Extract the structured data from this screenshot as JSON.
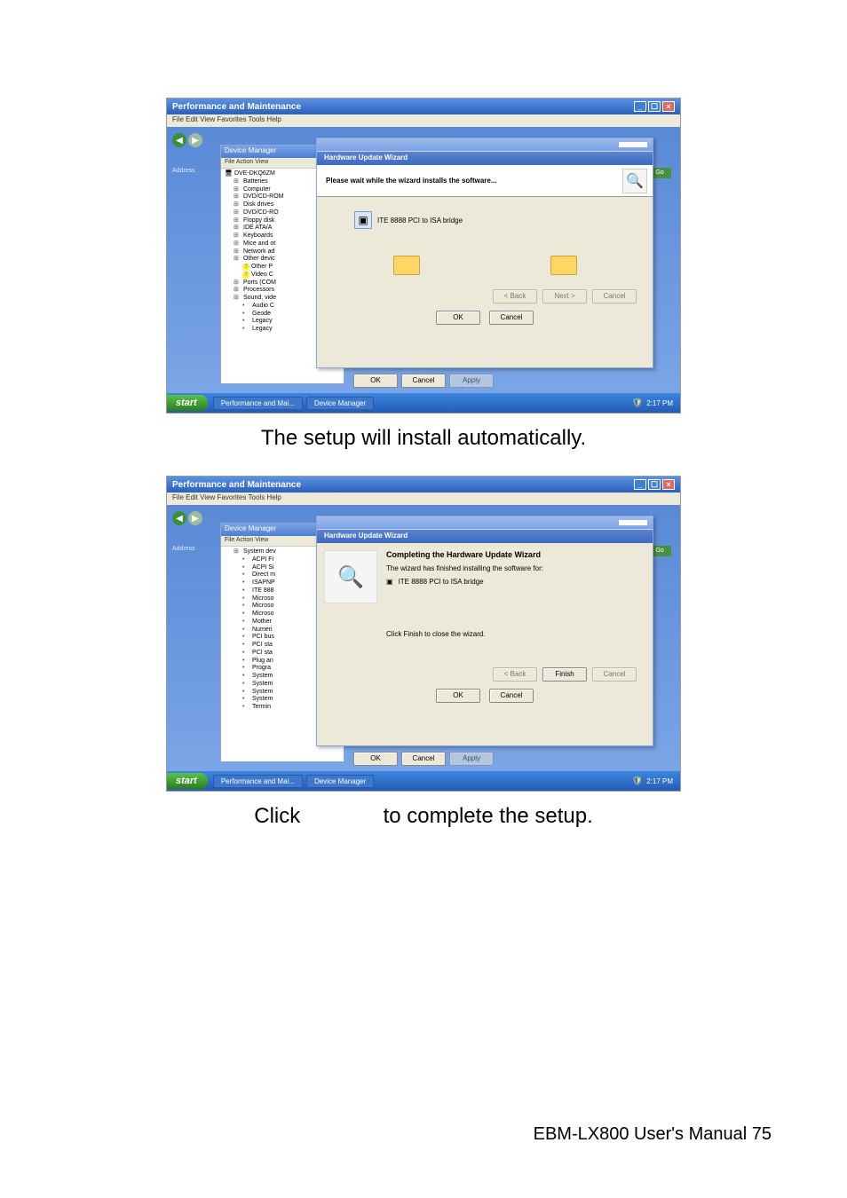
{
  "caption1": "The setup will install automatically.",
  "caption2": "Click              to complete the setup.",
  "footer": "EBM-LX800  User's  Manual 75",
  "strings": {
    "pm_title": "Performance and Maintenance",
    "pm_menu": "File   Edit   View   Favorites   Tools   Help",
    "go": "Go",
    "address": "Address",
    "dm_title": "Device Manager",
    "dm_menu": "File   Action   View",
    "prop_tag1": "?",
    "prop_tag2": "×",
    "wiz_title": "Hardware Update Wizard",
    "wiz_wait": "Please wait while the wizard installs the software...",
    "device": "ITE 8888 PCI to ISA bridge",
    "back": "< Back",
    "next": "Next >",
    "cancel": "Cancel",
    "ok": "OK",
    "apply": "Apply",
    "finish": "Finish",
    "complete_hdr": "Completing the Hardware Update Wizard",
    "complete_line": "The wizard has finished installing the software for:",
    "complete_finishmsg": "Click Finish to close the wizard.",
    "start": "start",
    "task1": "Performance and Mai...",
    "task2": "Device Manager",
    "time": "2:17 PM"
  },
  "tree1": [
    {
      "cls": "lvl0",
      "txt": "DVE-DKQ6ZM"
    },
    {
      "cls": "lvl1",
      "txt": "Batteries"
    },
    {
      "cls": "lvl1",
      "txt": "Computer"
    },
    {
      "cls": "lvl1",
      "txt": "DVD/CD-ROM"
    },
    {
      "cls": "lvl1",
      "txt": "Disk drives"
    },
    {
      "cls": "lvl1",
      "txt": "DVD/CD-RO"
    },
    {
      "cls": "lvl1",
      "txt": "Floppy disk"
    },
    {
      "cls": "lvl1",
      "txt": "IDE ATA/A"
    },
    {
      "cls": "lvl1",
      "txt": "Keyboards"
    },
    {
      "cls": "lvl1",
      "txt": "Mice and ot"
    },
    {
      "cls": "lvl1",
      "txt": "Network ad"
    },
    {
      "cls": "lvl1",
      "txt": "Other devic"
    },
    {
      "cls": "lvl2 yellow",
      "txt": "Other P"
    },
    {
      "cls": "lvl2 yellow",
      "txt": "Video C"
    },
    {
      "cls": "lvl1",
      "txt": "Ports (COM"
    },
    {
      "cls": "lvl1",
      "txt": "Processors"
    },
    {
      "cls": "lvl1",
      "txt": "Sound, vide"
    },
    {
      "cls": "lvl2",
      "txt": "Audio C"
    },
    {
      "cls": "lvl2",
      "txt": "Geode"
    },
    {
      "cls": "lvl2",
      "txt": "Legacy"
    },
    {
      "cls": "lvl2",
      "txt": "Legacy"
    }
  ],
  "tree2": [
    {
      "cls": "lvl1",
      "txt": "System dev"
    },
    {
      "cls": "lvl2",
      "txt": "ACPI Fi"
    },
    {
      "cls": "lvl2",
      "txt": "ACPI Si"
    },
    {
      "cls": "lvl2",
      "txt": "Direct m"
    },
    {
      "cls": "lvl2",
      "txt": "ISAPNP"
    },
    {
      "cls": "lvl2",
      "txt": "ITE 888"
    },
    {
      "cls": "lvl2",
      "txt": "Microso"
    },
    {
      "cls": "lvl2",
      "txt": "Microso"
    },
    {
      "cls": "lvl2",
      "txt": "Microso"
    },
    {
      "cls": "lvl2",
      "txt": "Mother"
    },
    {
      "cls": "lvl2",
      "txt": "Numeri"
    },
    {
      "cls": "lvl2",
      "txt": "PCI bus"
    },
    {
      "cls": "lvl2",
      "txt": "PCI sta"
    },
    {
      "cls": "lvl2",
      "txt": "PCI sta"
    },
    {
      "cls": "lvl2",
      "txt": "Plug an"
    },
    {
      "cls": "lvl2",
      "txt": "Progra"
    },
    {
      "cls": "lvl2",
      "txt": "System"
    },
    {
      "cls": "lvl2",
      "txt": "System"
    },
    {
      "cls": "lvl2",
      "txt": "System"
    },
    {
      "cls": "lvl2",
      "txt": "System"
    },
    {
      "cls": "lvl2",
      "txt": "Termin"
    }
  ]
}
